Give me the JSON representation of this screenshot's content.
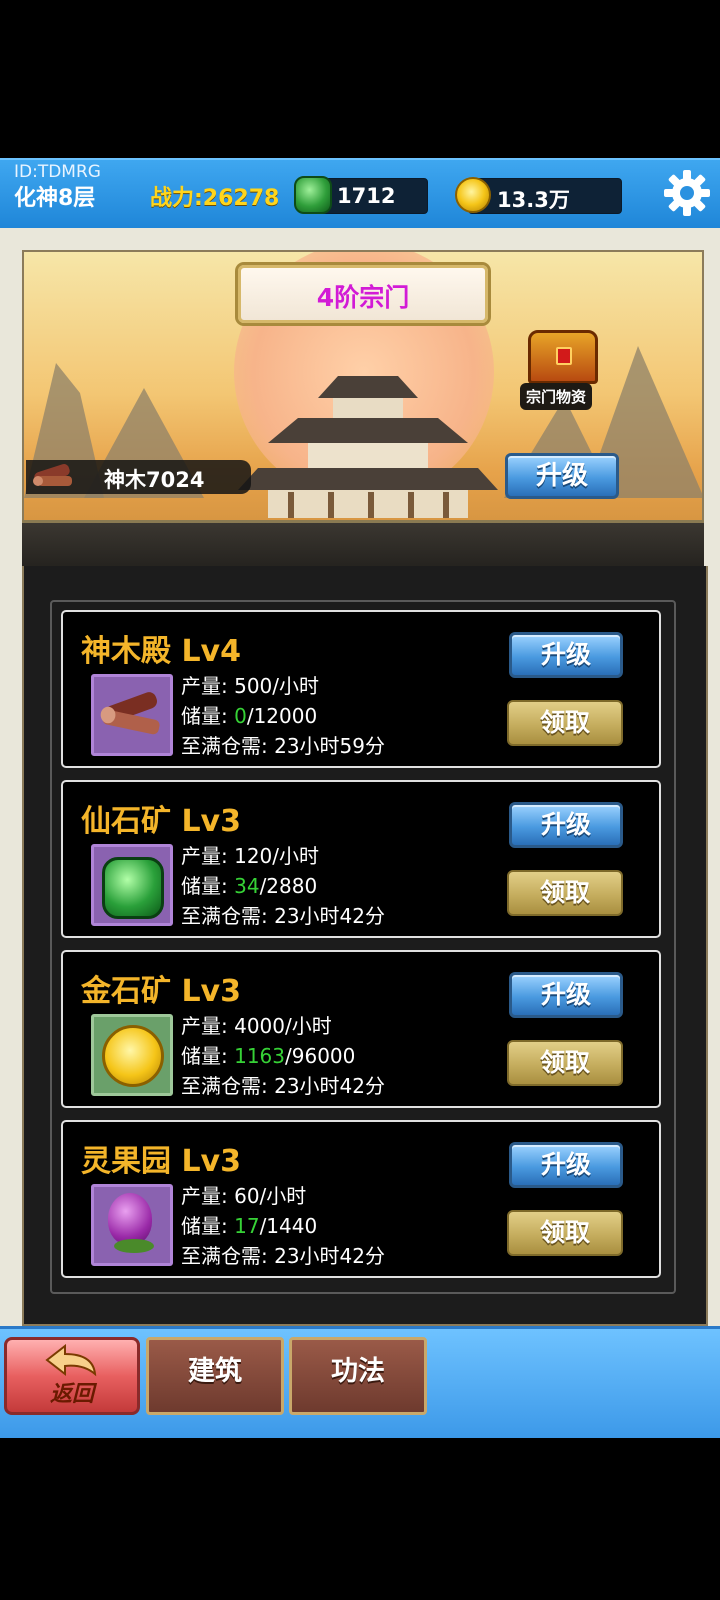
{
  "header": {
    "player_id": "ID:TDMRG",
    "realm": "化神8层",
    "power": "战力:26278",
    "jade_count": "1712",
    "gold_count": "13.3万",
    "icons": {
      "jade": "jade-stone-icon",
      "gold": "gold-coin-icon",
      "settings": "gear-icon"
    }
  },
  "sect": {
    "title": "4阶宗门",
    "supplies_label": "宗门物资",
    "wood_label": "神木7024",
    "upgrade_label": "升级"
  },
  "buildings": [
    {
      "name": "神木殿 Lv4",
      "rate_prefix": "产量: ",
      "rate": "500/小时",
      "storage_prefix": "储量: ",
      "stored": "0",
      "capacity": "/12000",
      "full_prefix": "至满仓需: ",
      "full_time": "23小时59分",
      "upgrade": "升级",
      "collect": "领取",
      "icon": "wood-log-icon"
    },
    {
      "name": "仙石矿 Lv3",
      "rate_prefix": "产量: ",
      "rate": "120/小时",
      "storage_prefix": "储量: ",
      "stored": "34",
      "capacity": "/2880",
      "full_prefix": "至满仓需: ",
      "full_time": "23小时42分",
      "upgrade": "升级",
      "collect": "领取",
      "icon": "jade-stone-icon"
    },
    {
      "name": "金石矿 Lv3",
      "rate_prefix": "产量: ",
      "rate": "4000/小时",
      "storage_prefix": "储量: ",
      "stored": "1163",
      "capacity": "/96000",
      "full_prefix": "至满仓需: ",
      "full_time": "23小时42分",
      "upgrade": "升级",
      "collect": "领取",
      "icon": "gold-coin-icon"
    },
    {
      "name": "灵果园 Lv3",
      "rate_prefix": "产量: ",
      "rate": "60/小时",
      "storage_prefix": "储量: ",
      "stored": "17",
      "capacity": "/1440",
      "full_prefix": "至满仓需: ",
      "full_time": "23小时42分",
      "upgrade": "升级",
      "collect": "领取",
      "icon": "spirit-fruit-icon"
    }
  ],
  "nav": {
    "back_label": "返回",
    "tabs": [
      "建筑",
      "功法"
    ]
  },
  "colors": {
    "header_blue": "#2a91e0",
    "power_yellow": "#ffd51c",
    "title_gold": "#f4b52a",
    "stored_green": "#36d236",
    "banner_magenta": "#d21bd6"
  }
}
